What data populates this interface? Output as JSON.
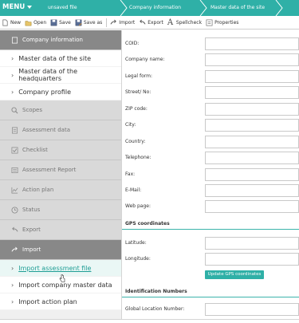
{
  "topbar": {
    "menu_label": "MENU",
    "crumbs": [
      "unsaved file",
      "Company information",
      "Master data of the site"
    ],
    "accent": "#2fb0a7"
  },
  "toolbar": {
    "items": [
      {
        "label": "New",
        "icon": "new-file-icon"
      },
      {
        "label": "Open",
        "icon": "open-folder-icon"
      },
      {
        "label": "Save",
        "icon": "save-icon"
      },
      {
        "label": "Save as",
        "icon": "save-as-icon"
      },
      {
        "label": "Import",
        "icon": "import-icon"
      },
      {
        "label": "Export",
        "icon": "export-icon"
      },
      {
        "label": "Spellcheck",
        "icon": "spellcheck-icon"
      },
      {
        "label": "Properties",
        "icon": "properties-icon"
      }
    ]
  },
  "sidebar": {
    "company_information": "Company information",
    "company_subitems": [
      "Master data of the site",
      "Master data of the headquarters",
      "Company profile"
    ],
    "sections": [
      "Scopes",
      "Assessment data",
      "Checklist",
      "Assessment Report",
      "Action plan",
      "Status",
      "Export"
    ],
    "import_label": "Import",
    "import_subitems": [
      "Import assessment file",
      "Import company master data",
      "Import action plan"
    ]
  },
  "form": {
    "fields": [
      "COID:",
      "Company name:",
      "Legal form:",
      "Street/ No:",
      "ZIP code:",
      "City:",
      "Country:",
      "Telephone:",
      "Fax:",
      "E-Mail:",
      "Web page:"
    ],
    "gps_title": "GPS coordinates",
    "gps_fields": [
      "Latitude:",
      "Longitude:"
    ],
    "gps_button": "Update GPS coordinates",
    "id_title": "Identification Numbers",
    "id_fields": [
      "Global Location Number:"
    ]
  }
}
